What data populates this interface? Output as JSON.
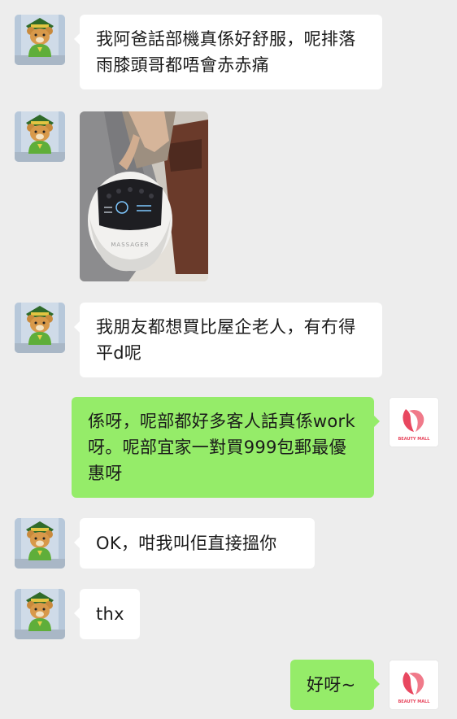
{
  "messages": [
    {
      "text": "我阿爸話部機真係好舒服，呢排落雨膝頭哥都唔會赤赤痛"
    },
    {
      "image_label": "MASSAGER"
    },
    {
      "text": "我朋友都想買比屋企老人，有冇得平d呢"
    },
    {
      "text": "係呀，呢部都好多客人話真係work呀。呢部宜家一對買999包郵最優惠呀"
    },
    {
      "text": "OK，咁我叫佢直接搵你"
    },
    {
      "text": "thx"
    },
    {
      "text": "好呀~"
    }
  ],
  "brand": {
    "name": "BEAUTY MALL",
    "color": "#e8475f"
  },
  "colors": {
    "incoming": "#ffffff",
    "outgoing": "#95ec69",
    "background": "#ededed"
  }
}
